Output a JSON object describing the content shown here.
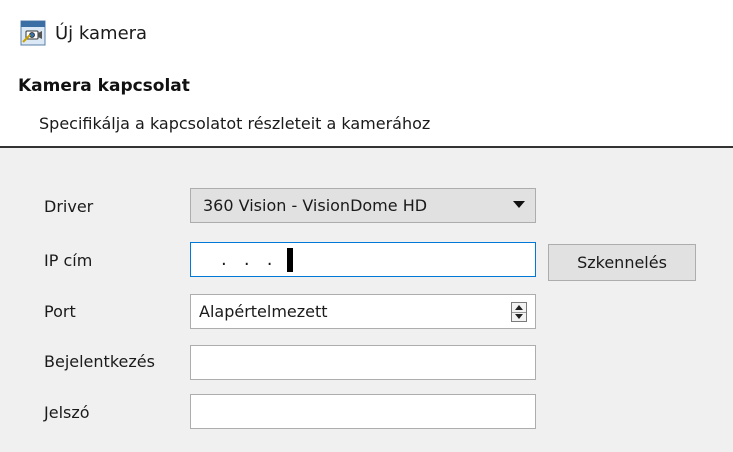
{
  "window": {
    "title": "Új kamera",
    "icon": "camera-wizard-icon"
  },
  "section": {
    "heading": "Kamera kapcsolat",
    "subheading": "Specifikálja a kapcsolatot részleteit a kamerához"
  },
  "form": {
    "driver": {
      "label": "Driver",
      "value": "360 Vision - VisionDome HD"
    },
    "ip": {
      "label": "IP cím",
      "value": ".   .   .",
      "scan_button": "Szkennelés"
    },
    "port": {
      "label": "Port",
      "value": "Alapértelmezett"
    },
    "login": {
      "label": "Bejelentkezés",
      "value": ""
    },
    "password": {
      "label": "Jelszó",
      "value": ""
    }
  },
  "colors": {
    "accent": "#0078d7",
    "panel": "#f0f0f0",
    "button": "#e1e1e1"
  }
}
